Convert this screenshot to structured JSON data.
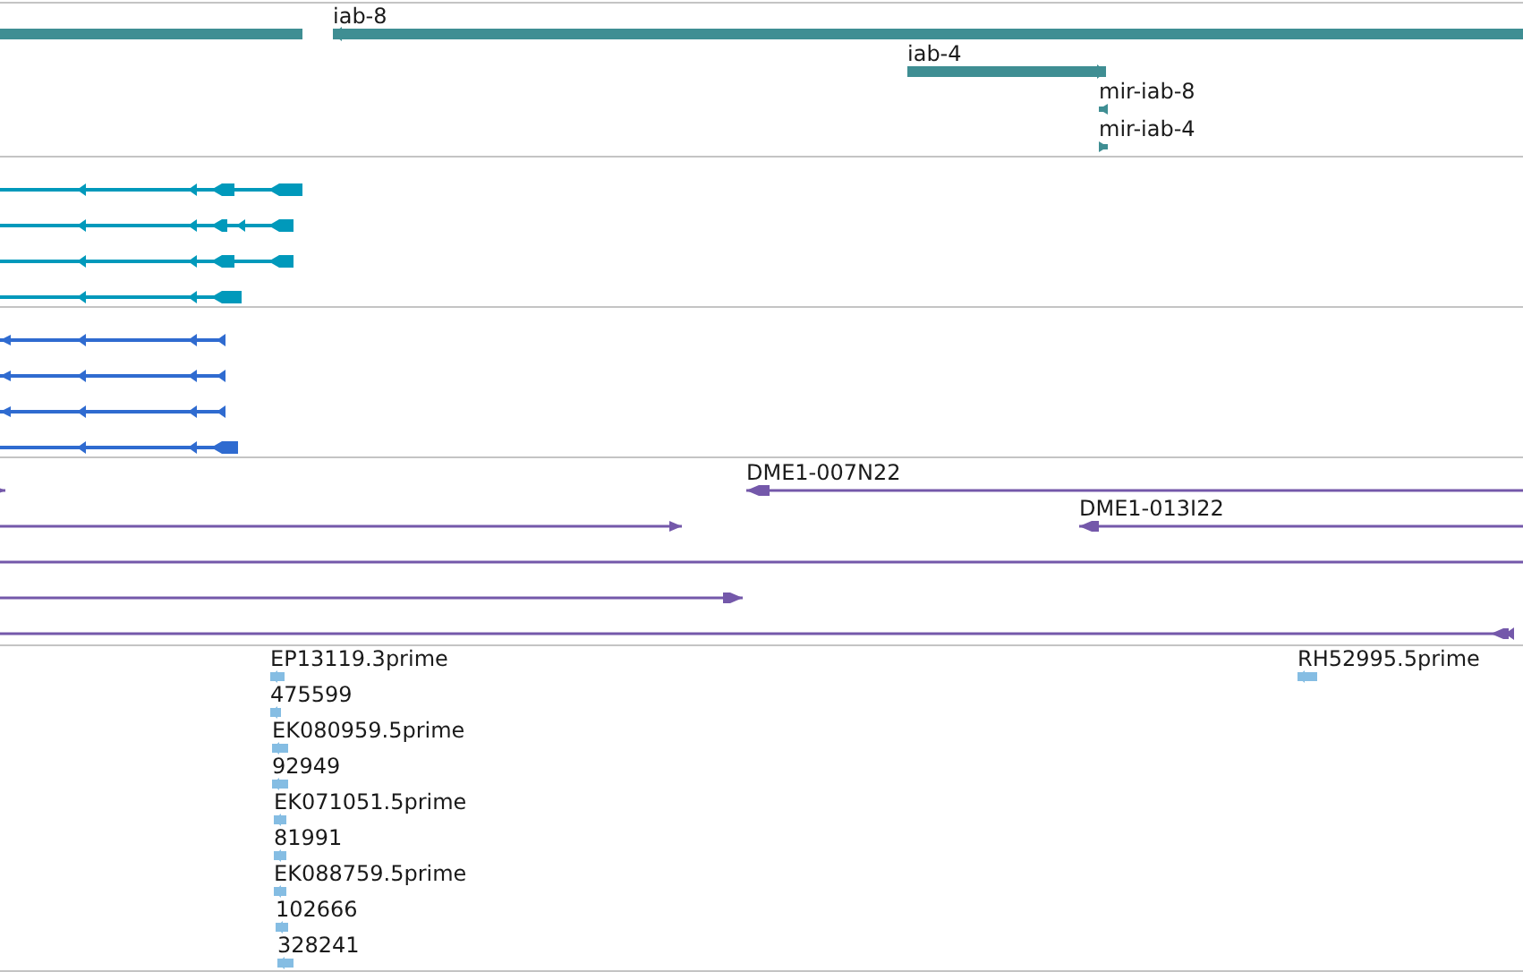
{
  "tracks": [
    {
      "kind": "gene",
      "color": "#3f8e93",
      "features": [
        {
          "reverse_strand": true
        },
        {
          "label": "iab-8",
          "reverse_strand": true
        },
        {
          "label": "iab-4",
          "reverse_strand": false
        },
        {
          "label": "mir-iab-8",
          "reverse_strand": true
        },
        {
          "label": "mir-iab-4",
          "reverse_strand": false
        }
      ]
    },
    {
      "kind": "transcript",
      "color": "#0099bb",
      "features": [
        {
          "reverse_strand": true
        },
        {
          "reverse_strand": true
        },
        {
          "reverse_strand": true
        },
        {
          "reverse_strand": true
        }
      ]
    },
    {
      "kind": "transcript",
      "color": "#2f6bd0",
      "features": [
        {
          "reverse_strand": true
        },
        {
          "reverse_strand": true
        },
        {
          "reverse_strand": true
        },
        {
          "reverse_strand": true
        }
      ]
    },
    {
      "kind": "clone",
      "color": "#7458aa",
      "features": [
        {
          "reverse_strand": false
        },
        {
          "label": "DME1-007N22",
          "reverse_strand": true
        },
        {
          "reverse_strand": false
        },
        {
          "label": "DME1-013I22",
          "reverse_strand": true
        },
        {
          "reverse_strand": true
        },
        {
          "reverse_strand": false
        },
        {
          "reverse_strand": true
        }
      ]
    },
    {
      "kind": "est",
      "color": "#85bde3",
      "features": [
        {
          "label": "EP13119.3prime",
          "reverse_strand": true
        },
        {
          "label": "475599",
          "reverse_strand": true
        },
        {
          "label": "EK080959.5prime",
          "reverse_strand": true
        },
        {
          "label": "92949",
          "reverse_strand": true
        },
        {
          "label": "EK071051.5prime",
          "reverse_strand": true
        },
        {
          "label": "81991",
          "reverse_strand": true
        },
        {
          "label": "EK088759.5prime",
          "reverse_strand": true
        },
        {
          "label": "102666",
          "reverse_strand": true
        },
        {
          "label": "328241",
          "reverse_strand": true
        },
        {
          "label": "RH52995.5prime",
          "reverse_strand": true
        }
      ]
    }
  ]
}
